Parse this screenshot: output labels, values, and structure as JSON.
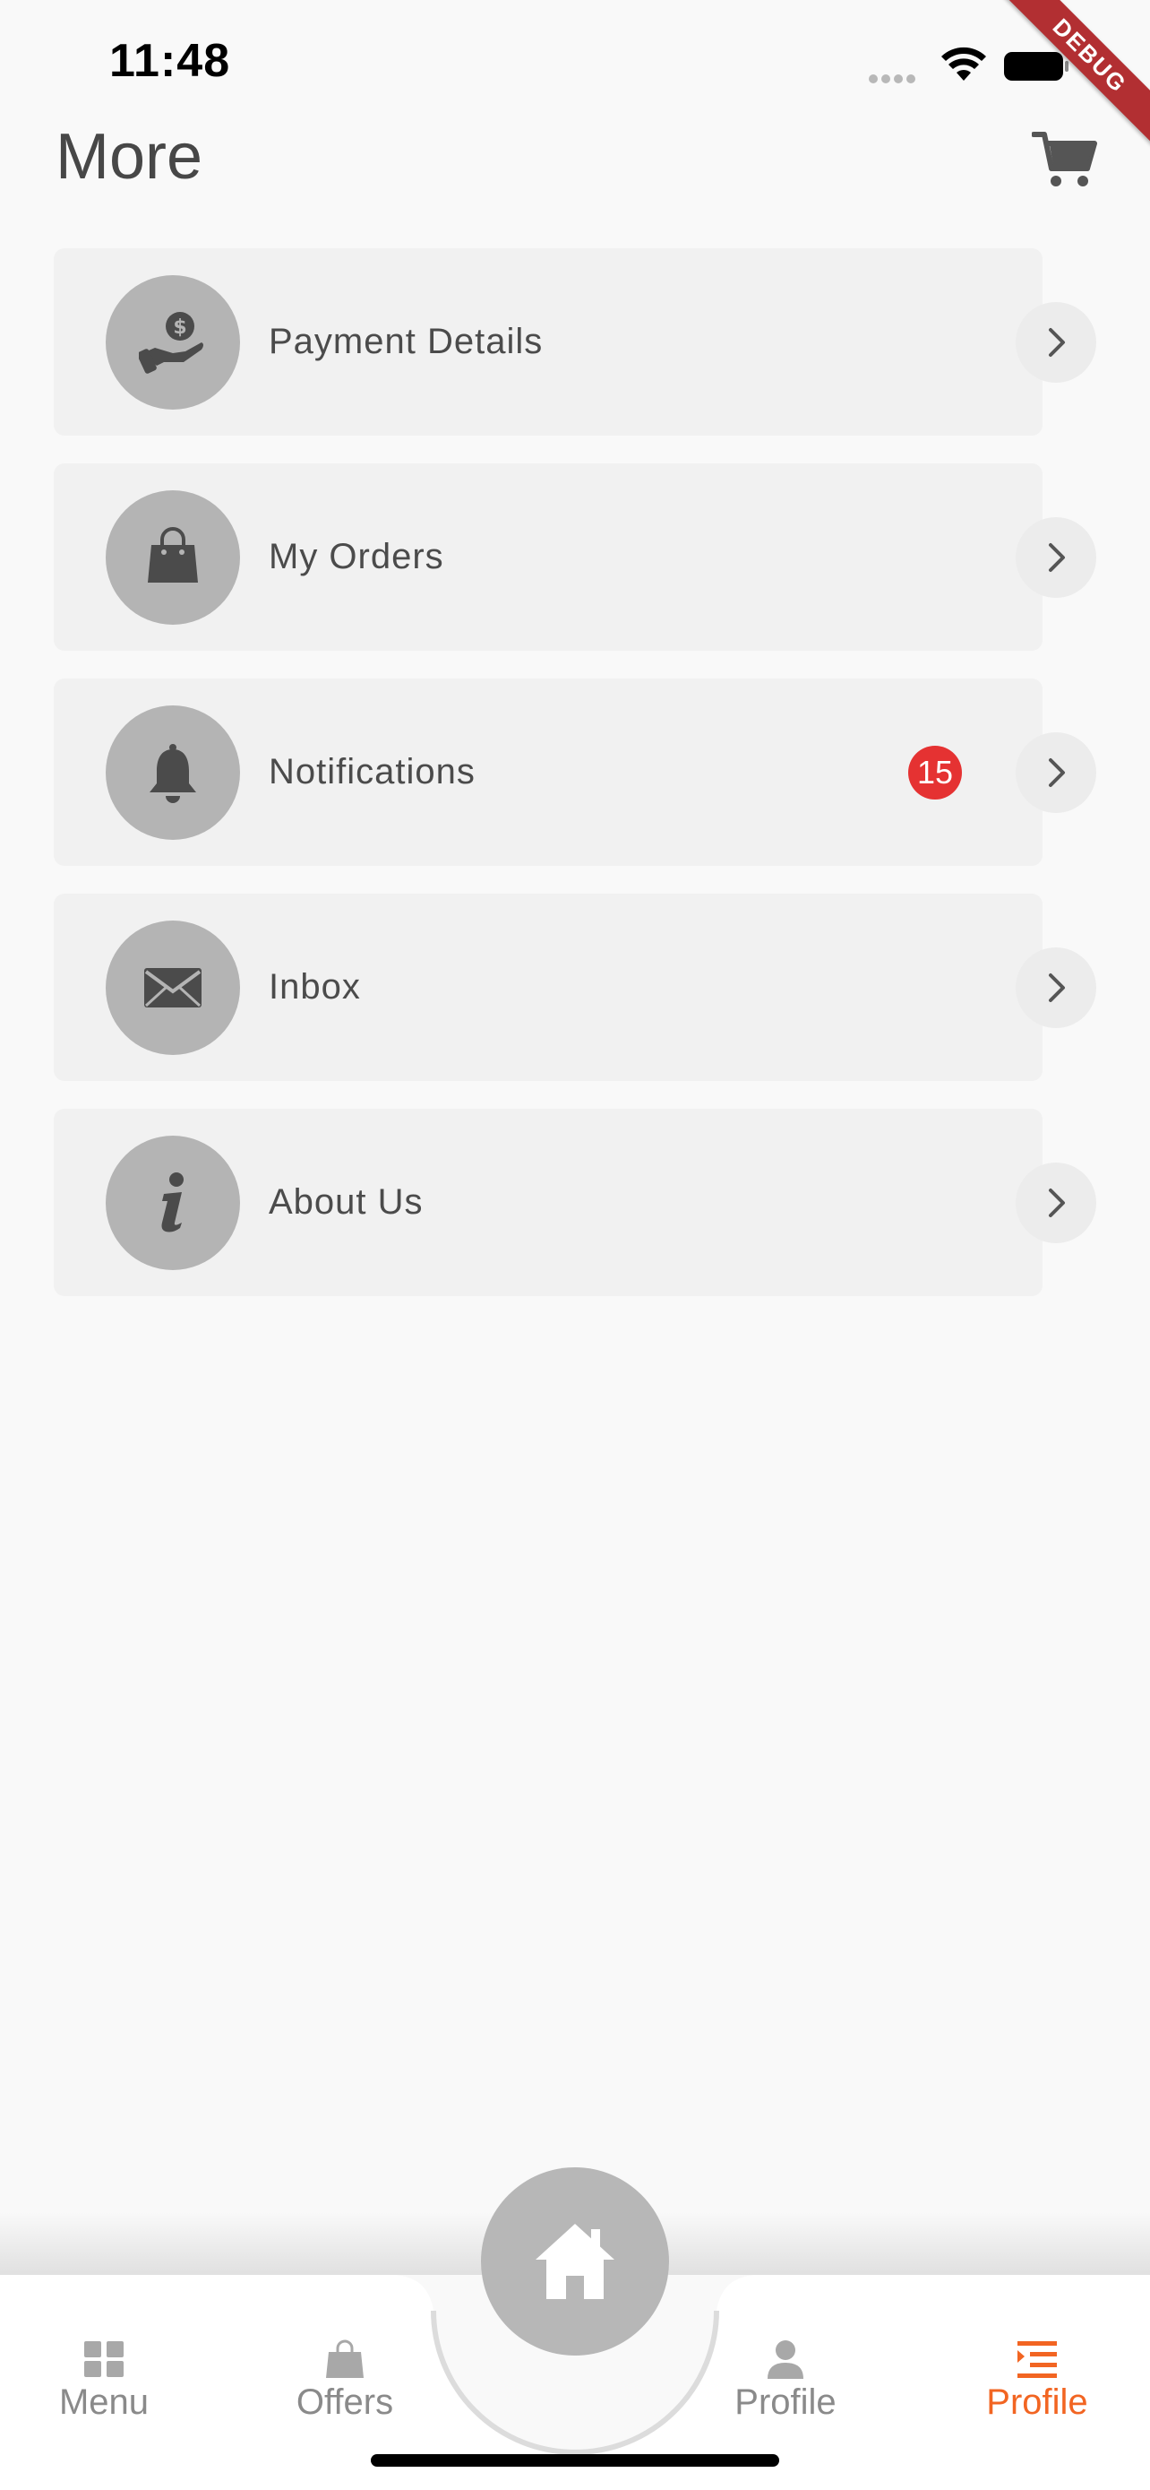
{
  "status_bar": {
    "time": "11:48"
  },
  "debug_banner": "DEBUG",
  "header": {
    "title": "More",
    "cart_icon": "cart-icon"
  },
  "menu": {
    "items": [
      {
        "label": "Payment Details",
        "icon": "payment-hand-icon",
        "badge": null
      },
      {
        "label": "My Orders",
        "icon": "shopping-bag-icon",
        "badge": null
      },
      {
        "label": "Notifications",
        "icon": "bell-icon",
        "badge": "15"
      },
      {
        "label": "Inbox",
        "icon": "envelope-icon",
        "badge": null
      },
      {
        "label": "About Us",
        "icon": "info-icon",
        "badge": null
      }
    ]
  },
  "bottom_nav": {
    "items": [
      {
        "label": "Menu",
        "icon": "grid-icon",
        "active": false
      },
      {
        "label": "Offers",
        "icon": "shopping-bag-icon",
        "active": false
      },
      {
        "label": "Profile",
        "icon": "person-icon",
        "active": false
      },
      {
        "label": "Profile",
        "icon": "list-icon",
        "active": true
      }
    ],
    "home_icon": "home-icon"
  },
  "colors": {
    "accent": "#f26522",
    "badge": "#e53232",
    "icon_circle": "#b4b4b4",
    "card_bg": "#f1f1f1",
    "text": "#4b4b4b",
    "debug_ribbon": "#b22f32"
  }
}
